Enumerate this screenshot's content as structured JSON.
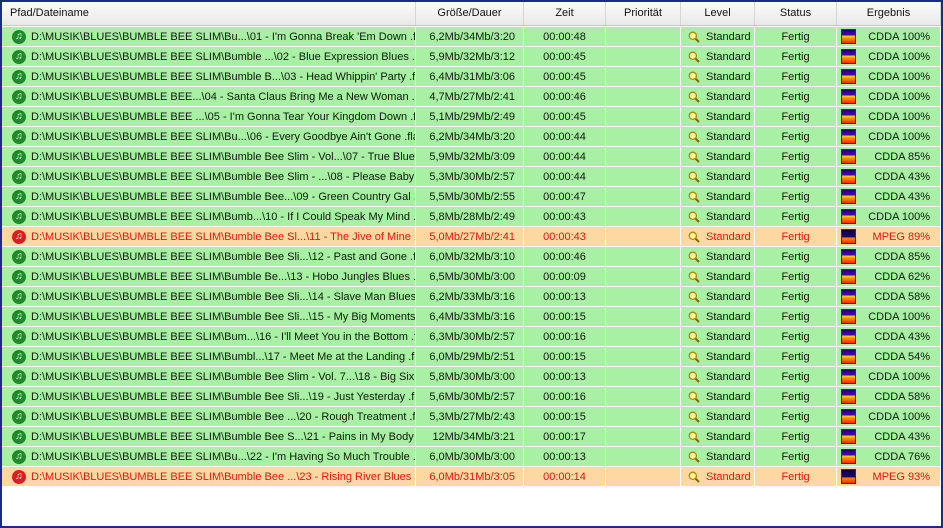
{
  "headers": {
    "path": "Pfad/Dateiname",
    "size": "Größe/Dauer",
    "time": "Zeit",
    "priority": "Priorität",
    "level": "Level",
    "status": "Status",
    "result": "Ergebnis"
  },
  "colors": {
    "ok_row": "#a8f0a3",
    "warn_row": "#fbd9a0",
    "warn_text": "#e01818",
    "frame": "#1c2a8c"
  },
  "icons": {
    "file": "music-note-icon",
    "level": "magnifier-icon",
    "result": "spectrum-icon"
  },
  "rows": [
    {
      "path": "D:\\MUSIK\\BLUES\\BUMBLE BEE SLIM\\Bu...\\01 - I'm Gonna Break 'Em Down .flac",
      "size": "6,2Mb/34Mb/3:20",
      "time": "00:00:48",
      "priority": "",
      "level": "Standard",
      "status": "Fertig",
      "result": "CDDA 100%",
      "state": "ok",
      "type": "cdda"
    },
    {
      "path": "D:\\MUSIK\\BLUES\\BUMBLE BEE SLIM\\Bumble ...\\02 - Blue Expression Blues .flac",
      "size": "5,9Mb/32Mb/3:12",
      "time": "00:00:45",
      "priority": "",
      "level": "Standard",
      "status": "Fertig",
      "result": "CDDA 100%",
      "state": "ok",
      "type": "cdda"
    },
    {
      "path": "D:\\MUSIK\\BLUES\\BUMBLE BEE SLIM\\Bumble B...\\03 - Head Whippin' Party .flac",
      "size": "6,4Mb/31Mb/3:06",
      "time": "00:00:45",
      "priority": "",
      "level": "Standard",
      "status": "Fertig",
      "result": "CDDA 100%",
      "state": "ok",
      "type": "cdda"
    },
    {
      "path": "D:\\MUSIK\\BLUES\\BUMBLE BEE...\\04 - Santa Claus Bring Me a New Woman .flac",
      "size": "4,7Mb/27Mb/2:41",
      "time": "00:00:46",
      "priority": "",
      "level": "Standard",
      "status": "Fertig",
      "result": "CDDA 100%",
      "state": "ok",
      "type": "cdda"
    },
    {
      "path": "D:\\MUSIK\\BLUES\\BUMBLE BEE ...\\05 - I'm Gonna Tear Your Kingdom Down .flac",
      "size": "5,1Mb/29Mb/2:49",
      "time": "00:00:45",
      "priority": "",
      "level": "Standard",
      "status": "Fertig",
      "result": "CDDA 100%",
      "state": "ok",
      "type": "cdda"
    },
    {
      "path": "D:\\MUSIK\\BLUES\\BUMBLE BEE SLIM\\Bu...\\06 - Every Goodbye Ain't Gone .flac",
      "size": "6,2Mb/34Mb/3:20",
      "time": "00:00:44",
      "priority": "",
      "level": "Standard",
      "status": "Fertig",
      "result": "CDDA 100%",
      "state": "ok",
      "type": "cdda"
    },
    {
      "path": "D:\\MUSIK\\BLUES\\BUMBLE BEE SLIM\\Bumble Bee Slim - Vol...\\07 - True Blue .flac",
      "size": "5,9Mb/32Mb/3:09",
      "time": "00:00:44",
      "priority": "",
      "level": "Standard",
      "status": "Fertig",
      "result": "CDDA 85%",
      "state": "ok",
      "type": "cdda"
    },
    {
      "path": "D:\\MUSIK\\BLUES\\BUMBLE BEE SLIM\\Bumble Bee Slim - ...\\08 - Please Baby .flac",
      "size": "5,3Mb/30Mb/2:57",
      "time": "00:00:44",
      "priority": "",
      "level": "Standard",
      "status": "Fertig",
      "result": "CDDA 43%",
      "state": "ok",
      "type": "cdda"
    },
    {
      "path": "D:\\MUSIK\\BLUES\\BUMBLE BEE SLIM\\Bumble Bee...\\09 - Green Country Gal .flac",
      "size": "5,5Mb/30Mb/2:55",
      "time": "00:00:47",
      "priority": "",
      "level": "Standard",
      "status": "Fertig",
      "result": "CDDA 43%",
      "state": "ok",
      "type": "cdda"
    },
    {
      "path": "D:\\MUSIK\\BLUES\\BUMBLE BEE SLIM\\Bumb...\\10 - If I Could Speak My Mind .flac",
      "size": "5,8Mb/28Mb/2:49",
      "time": "00:00:43",
      "priority": "",
      "level": "Standard",
      "status": "Fertig",
      "result": "CDDA 100%",
      "state": "ok",
      "type": "cdda"
    },
    {
      "path": "D:\\MUSIK\\BLUES\\BUMBLE BEE SLIM\\Bumble Bee Sl...\\11 - The Jive of Mine .flac",
      "size": "5,0Mb/27Mb/2:41",
      "time": "00:00:43",
      "priority": "",
      "level": "Standard",
      "status": "Fertig",
      "result": "MPEG 89%",
      "state": "warn",
      "type": "mpeg"
    },
    {
      "path": "D:\\MUSIK\\BLUES\\BUMBLE BEE SLIM\\Bumble Bee Sli...\\12 - Past and Gone .flac",
      "size": "6,0Mb/32Mb/3:10",
      "time": "00:00:46",
      "priority": "",
      "level": "Standard",
      "status": "Fertig",
      "result": "CDDA 85%",
      "state": "ok",
      "type": "cdda"
    },
    {
      "path": "D:\\MUSIK\\BLUES\\BUMBLE BEE SLIM\\Bumble Be...\\13 - Hobo Jungles Blues .flac",
      "size": "6,5Mb/30Mb/3:00",
      "time": "00:00:09",
      "priority": "",
      "level": "Standard",
      "status": "Fertig",
      "result": "CDDA 62%",
      "state": "ok",
      "type": "cdda"
    },
    {
      "path": "D:\\MUSIK\\BLUES\\BUMBLE BEE SLIM\\Bumble Bee Sli...\\14 - Slave Man Blues .flac",
      "size": "6,2Mb/33Mb/3:16",
      "time": "00:00:13",
      "priority": "",
      "level": "Standard",
      "status": "Fertig",
      "result": "CDDA 58%",
      "state": "ok",
      "type": "cdda"
    },
    {
      "path": "D:\\MUSIK\\BLUES\\BUMBLE BEE SLIM\\Bumble Bee Sli...\\15 - My Big Moments .flac",
      "size": "6,4Mb/33Mb/3:16",
      "time": "00:00:15",
      "priority": "",
      "level": "Standard",
      "status": "Fertig",
      "result": "CDDA 100%",
      "state": "ok",
      "type": "cdda"
    },
    {
      "path": "D:\\MUSIK\\BLUES\\BUMBLE BEE SLIM\\Bum...\\16 - I'll Meet You in the Bottom .flac",
      "size": "6,3Mb/30Mb/2:57",
      "time": "00:00:16",
      "priority": "",
      "level": "Standard",
      "status": "Fertig",
      "result": "CDDA 43%",
      "state": "ok",
      "type": "cdda"
    },
    {
      "path": "D:\\MUSIK\\BLUES\\BUMBLE BEE SLIM\\Bumbl...\\17 - Meet Me at the Landing .flac",
      "size": "6,0Mb/29Mb/2:51",
      "time": "00:00:15",
      "priority": "",
      "level": "Standard",
      "status": "Fertig",
      "result": "CDDA 54%",
      "state": "ok",
      "type": "cdda"
    },
    {
      "path": "D:\\MUSIK\\BLUES\\BUMBLE BEE SLIM\\Bumble Bee Slim - Vol. 7...\\18 - Big Six .flac",
      "size": "5,8Mb/30Mb/3:00",
      "time": "00:00:13",
      "priority": "",
      "level": "Standard",
      "status": "Fertig",
      "result": "CDDA 100%",
      "state": "ok",
      "type": "cdda"
    },
    {
      "path": "D:\\MUSIK\\BLUES\\BUMBLE BEE SLIM\\Bumble Bee Sli...\\19 - Just Yesterday .flac",
      "size": "5,6Mb/30Mb/2:57",
      "time": "00:00:16",
      "priority": "",
      "level": "Standard",
      "status": "Fertig",
      "result": "CDDA 58%",
      "state": "ok",
      "type": "cdda"
    },
    {
      "path": "D:\\MUSIK\\BLUES\\BUMBLE BEE SLIM\\Bumble Bee ...\\20 - Rough Treatment .flac",
      "size": "5,3Mb/27Mb/2:43",
      "time": "00:00:15",
      "priority": "",
      "level": "Standard",
      "status": "Fertig",
      "result": "CDDA 100%",
      "state": "ok",
      "type": "cdda"
    },
    {
      "path": "D:\\MUSIK\\BLUES\\BUMBLE BEE SLIM\\Bumble Bee S...\\21 - Pains in My Body .flac",
      "size": "12Mb/34Mb/3:21",
      "time": "00:00:17",
      "priority": "",
      "level": "Standard",
      "status": "Fertig",
      "result": "CDDA 43%",
      "state": "ok",
      "type": "cdda"
    },
    {
      "path": "D:\\MUSIK\\BLUES\\BUMBLE BEE SLIM\\Bu...\\22 - I'm Having So Much Trouble .flac",
      "size": "6,0Mb/30Mb/3:00",
      "time": "00:00:13",
      "priority": "",
      "level": "Standard",
      "status": "Fertig",
      "result": "CDDA 76%",
      "state": "ok",
      "type": "cdda"
    },
    {
      "path": "D:\\MUSIK\\BLUES\\BUMBLE BEE SLIM\\Bumble Bee ...\\23 - Rising River Blues .flac",
      "size": "6,0Mb/31Mb/3:05",
      "time": "00:00:14",
      "priority": "",
      "level": "Standard",
      "status": "Fertig",
      "result": "MPEG 93%",
      "state": "warn",
      "type": "mpeg"
    }
  ]
}
